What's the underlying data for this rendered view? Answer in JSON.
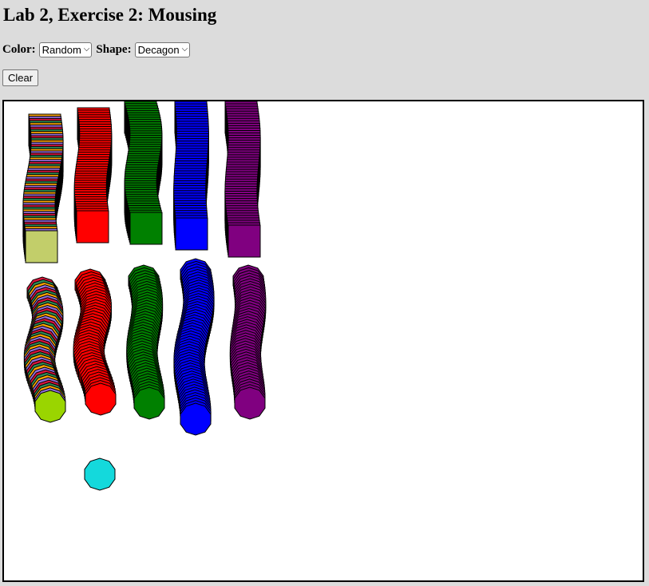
{
  "page": {
    "title": "Lab 2, Exercise 2: Mousing"
  },
  "controls": {
    "color_label": "Color:",
    "color_selected": "Random",
    "shape_label": "Shape:",
    "shape_selected": "Decagon",
    "clear_label": "Clear"
  },
  "canvas": {
    "stroke_color": "#000000",
    "square_trails": [
      {
        "color_mode": "random",
        "end_color": "#c2ce6a"
      },
      {
        "color_mode": "solid",
        "color": "#ff0000"
      },
      {
        "color_mode": "solid",
        "color": "#008000"
      },
      {
        "color_mode": "solid",
        "color": "#0000ff"
      },
      {
        "color_mode": "solid",
        "color": "#800080"
      }
    ],
    "decagon_trails": [
      {
        "color_mode": "random",
        "end_color": "#9ad500"
      },
      {
        "color_mode": "solid",
        "color": "#ff0000"
      },
      {
        "color_mode": "solid",
        "color": "#008000"
      },
      {
        "color_mode": "solid",
        "color": "#0000ff"
      },
      {
        "color_mode": "solid",
        "color": "#800080"
      }
    ],
    "single_decagon": {
      "color": "#14d9dc"
    },
    "random_palette": [
      "#2e8b57",
      "#ff6347",
      "#1e90ff",
      "#ffa500",
      "#9370db",
      "#20b2aa",
      "#ff69b4",
      "#8b4513",
      "#4682b4",
      "#d2691e",
      "#6b8e23",
      "#dc143c",
      "#00ced1",
      "#b8860b",
      "#9932cc",
      "#556b2f",
      "#ff8c00",
      "#4169e1",
      "#c71585",
      "#87ceeb"
    ]
  }
}
